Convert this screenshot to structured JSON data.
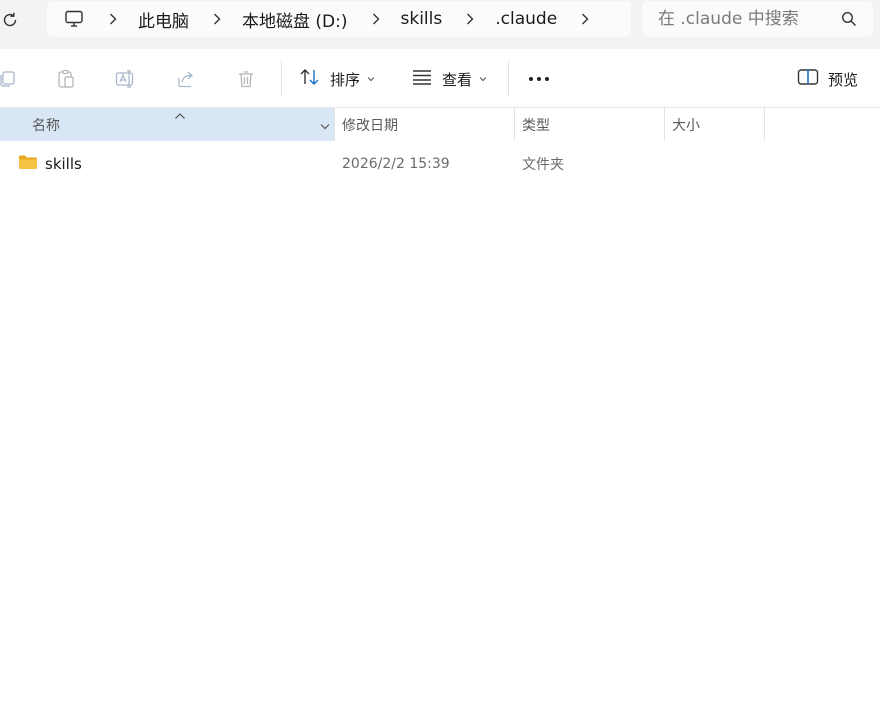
{
  "address_bar": {
    "breadcrumb": [
      "此电脑",
      "本地磁盘 (D:)",
      "skills",
      ".claude"
    ],
    "search_placeholder": "在 .claude 中搜索"
  },
  "command_bar": {
    "sort_label": "排序",
    "view_label": "查看",
    "preview_label": "预览"
  },
  "columns": {
    "name": "名称",
    "date_modified": "修改日期",
    "type": "类型",
    "size": "大小"
  },
  "files": [
    {
      "name": "skills",
      "date_modified": "2026/2/2 15:39",
      "type": "文件夹",
      "size": ""
    }
  ],
  "colors": {
    "accent": "#1a73c8",
    "selected_header": "#d8e6f6",
    "folder": "#f6c344"
  }
}
